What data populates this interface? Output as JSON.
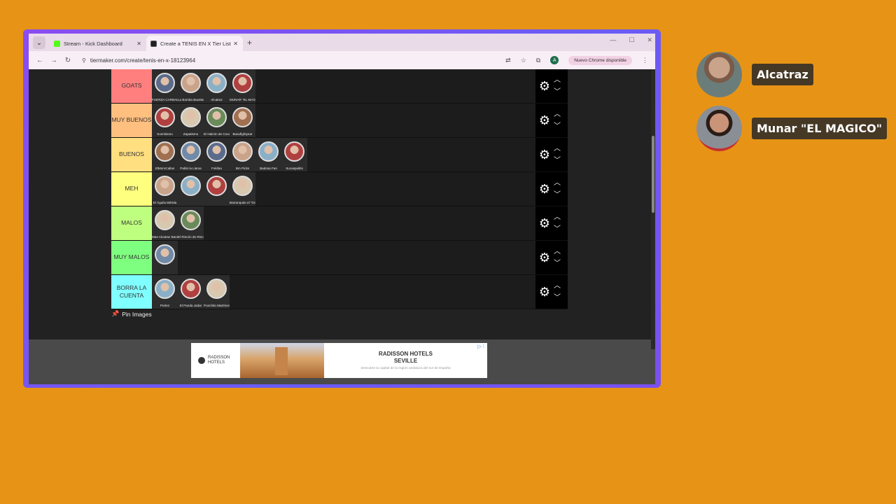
{
  "browser": {
    "tabs": [
      {
        "label": "Stream - Kick Dashboard",
        "favicon_color": "#53fc18",
        "active": false
      },
      {
        "label": "Create a TENIS EN X Tier List",
        "favicon_color": "#222222",
        "active": true
      }
    ],
    "new_tab_glyph": "+",
    "url": "tiermaker.com/create/tenis-en-x-18123964",
    "profile_initial": "A",
    "update_label": "Nuevo Chrome disponible"
  },
  "tierlist": {
    "tiers": [
      {
        "label": "GOATS",
        "color": "#ff7f7f",
        "items": [
          "FUERZA CARBALLES",
          "La Bomba Bautista",
          "Alcatraz",
          "MUNAR \"EL MAGICO\""
        ]
      },
      {
        "label": "MUY BUENOS",
        "color": "#ffbf7f",
        "items": [
          "Sonrisismo",
          "Zapatismo",
          "El Halcón de Covadonga",
          "Busufightyear"
        ]
      },
      {
        "label": "BUENOS",
        "color": "#ffdf7f",
        "items": [
          "ElMoroCallas",
          "Pablo la Llama",
          "Fokifan",
          "Bm Picks",
          "Badosa Fan",
          "Sucaspulitis"
        ]
      },
      {
        "label": "MEH",
        "color": "#ffff7f",
        "items": [
          "El Águila Mérida",
          "",
          "",
          "Barranquito el \"GOAT\""
        ]
      },
      {
        "label": "MALOS",
        "color": "#bfff7f",
        "items": [
          "Mas Alcatraz Bani",
          "El Rincón de Rincón"
        ]
      },
      {
        "label": "MUY MALOS",
        "color": "#7fff7f",
        "items": [
          ""
        ]
      },
      {
        "label": "BORRA LA CUENTA",
        "color": "#7fffff",
        "items": [
          "Portez",
          "El Panda Jodar",
          "Punchito Martínez"
        ]
      }
    ],
    "pin_label": "Pin Images"
  },
  "ad": {
    "brand": "RADISSON HOTELS",
    "title_line1": "RADISSON HOTELS",
    "title_line2": "SEVILLE",
    "subtitle": "Descubre la capital de la región andaluza del sur de España",
    "badge": "▷ ⁝"
  },
  "participants": [
    {
      "name": "Alcatraz"
    },
    {
      "name": "Munar \"EL MAGICO\""
    }
  ]
}
